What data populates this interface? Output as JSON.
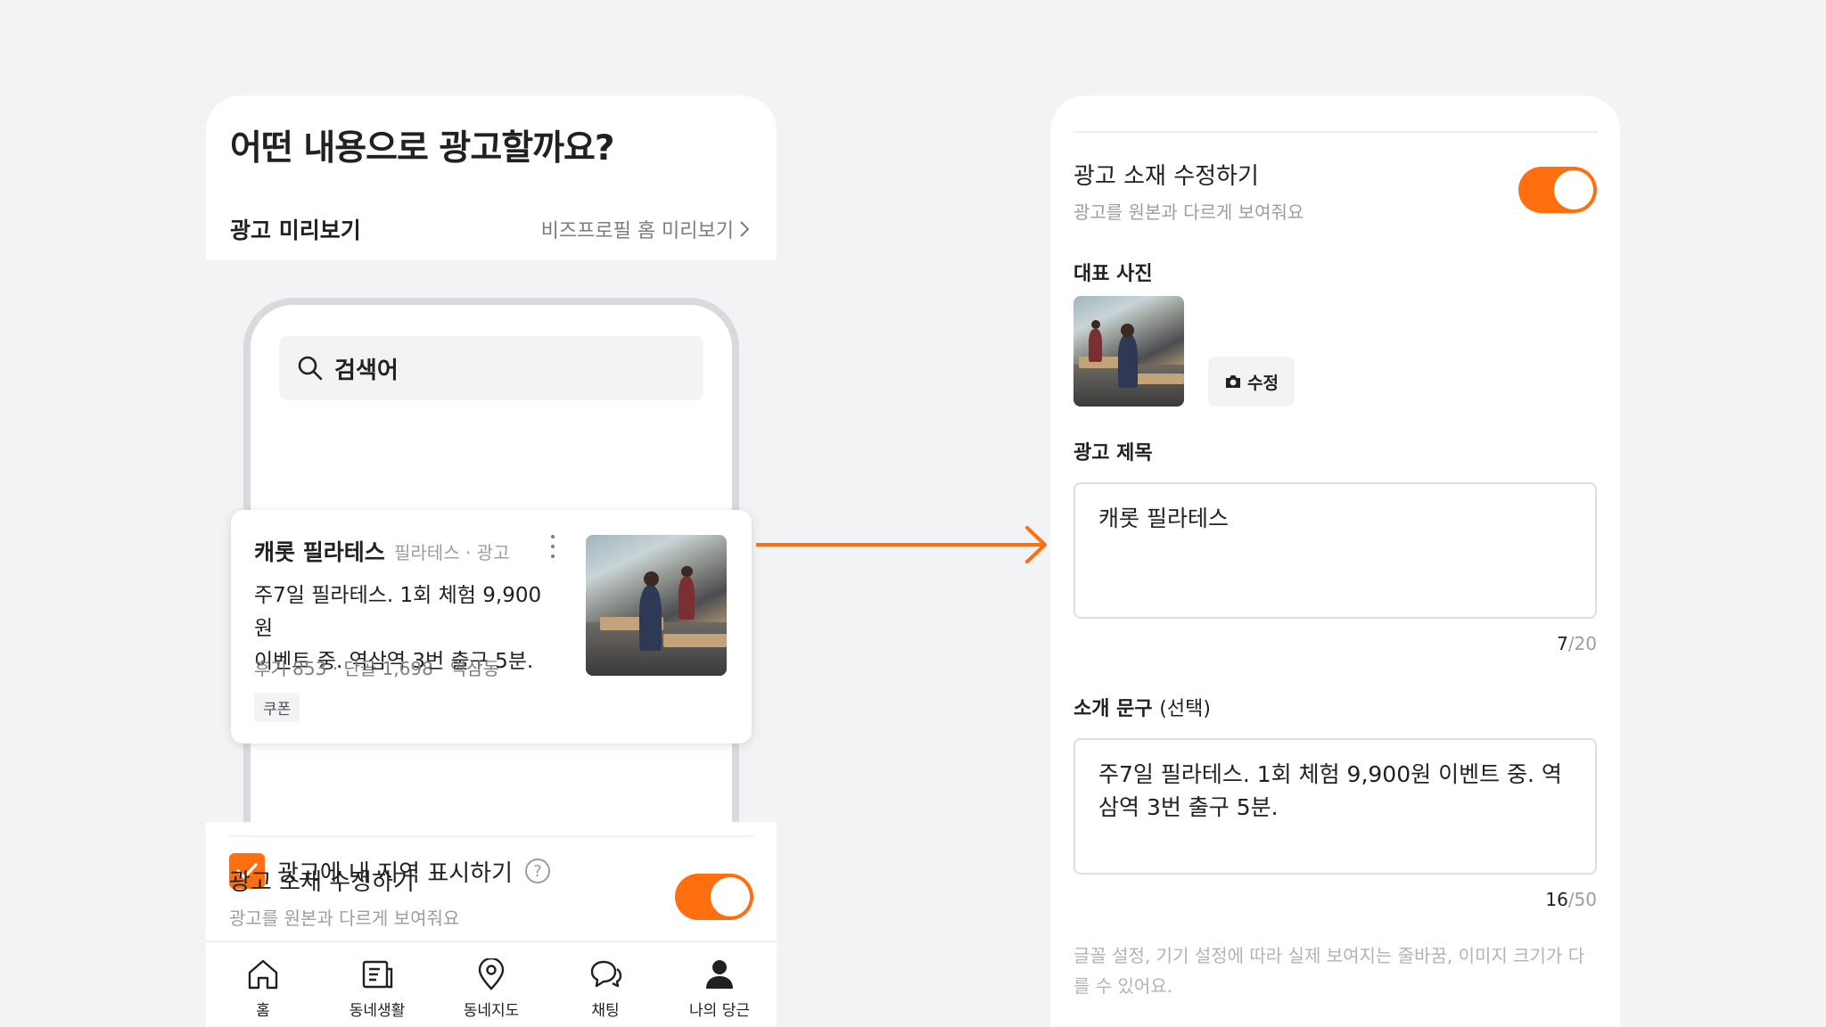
{
  "left": {
    "title": "어떤 내용으로 광고할까요?",
    "preview_label": "광고 미리보기",
    "preview_link": "비즈프로필 홈 미리보기",
    "search_placeholder": "검색어",
    "ad": {
      "name": "캐롯 필라테스",
      "meta": "필라테스 · 광고",
      "desc_line1": "주7일 필라테스. 1회 체험 9,900원",
      "desc_line2": "이벤트 중. 역삼역 3번 출구 5분.",
      "stats": "후기 853 · 단골 1,698 · 역삼동",
      "coupon": "쿠폰"
    },
    "region_checkbox_label": "광고에 내 지역 표시하기",
    "region_checked": true,
    "edit_title": "광고 소재 수정하기",
    "edit_sub": "광고를 원본과 다르게 보여줘요",
    "edit_toggle_on": true,
    "tabs": [
      {
        "label": "홈",
        "icon": "home-icon"
      },
      {
        "label": "동네생활",
        "icon": "board-icon"
      },
      {
        "label": "동네지도",
        "icon": "map-pin-icon"
      },
      {
        "label": "채팅",
        "icon": "chat-icon"
      },
      {
        "label": "나의 당근",
        "icon": "profile-icon"
      }
    ]
  },
  "right": {
    "edit_title": "광고 소재 수정하기",
    "edit_sub": "광고를 원본과 다르게 보여줘요",
    "edit_toggle_on": true,
    "photo_label": "대표 사진",
    "photo_edit_button": "수정",
    "ad_title_label": "광고 제목",
    "ad_title_value": "캐롯 필라테스",
    "ad_title_count": "7",
    "ad_title_max": "/20",
    "intro_label": "소개 문구",
    "intro_optional": "(선택)",
    "intro_value": "주7일 필라테스. 1회 체험 9,900원 이벤트 중. 역삼역 3번 출구 5분.",
    "intro_count": "16",
    "intro_max": "/50",
    "note": "글꼴 설정, 기기 설정에 따라 실제 보여지는 줄바꿈, 이미지 크기가 다를 수 있어요."
  },
  "colors": {
    "accent": "#FF6F0F",
    "background": "#F2F3F5",
    "text": "#212124",
    "muted": "#9A9DA3"
  }
}
